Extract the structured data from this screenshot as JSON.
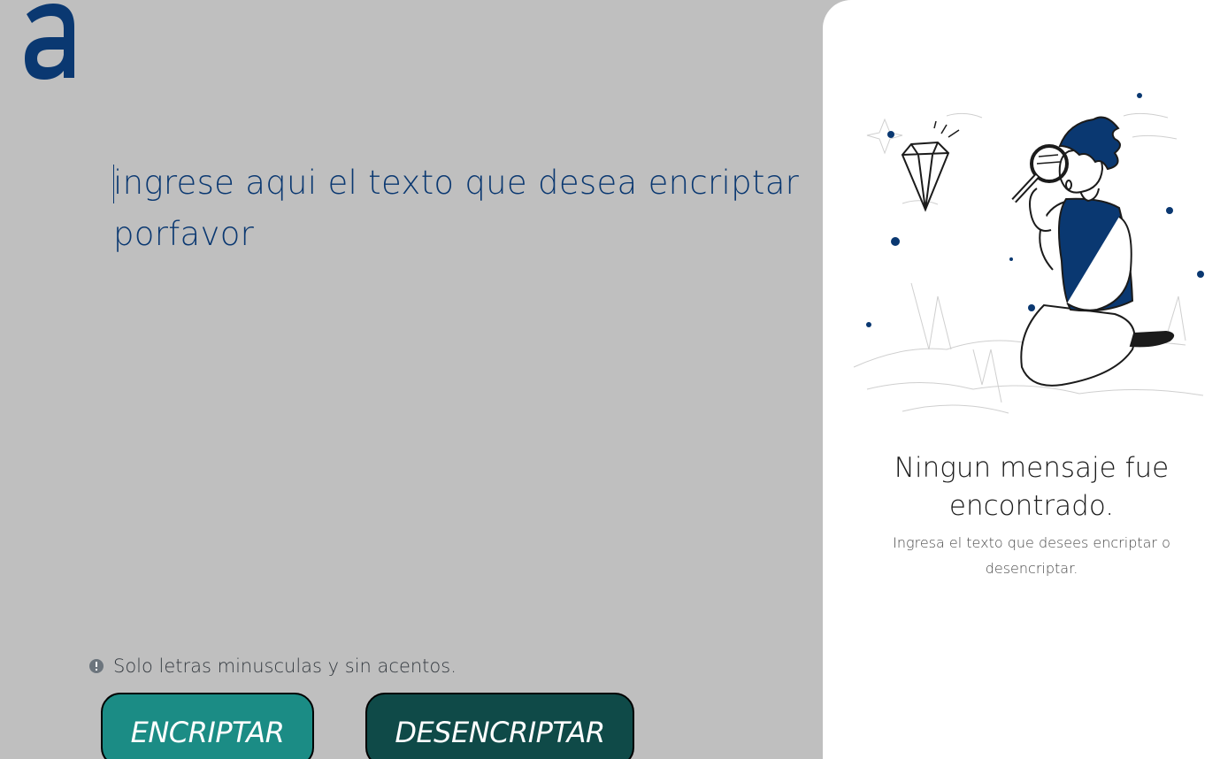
{
  "brand": {
    "logo_glyph": "a",
    "color": "#0a3871"
  },
  "input": {
    "placeholder": "ingrese aqui el texto que desea encriptar porfavor",
    "value": ""
  },
  "hint": {
    "icon": "info-circle-icon",
    "text": "Solo letras minusculas y sin acentos."
  },
  "buttons": {
    "encrypt_label": "ENCRIPTAR",
    "decrypt_label": "DESENCRIPTAR",
    "encrypt_color": "#1b8c85",
    "decrypt_color": "#0f4a48"
  },
  "output": {
    "illustration": "person-with-magnifying-glass-illustration",
    "title": "Ningun mensaje fue encontrado.",
    "subtitle": "Ingresa el texto que desees encriptar o desencriptar."
  }
}
